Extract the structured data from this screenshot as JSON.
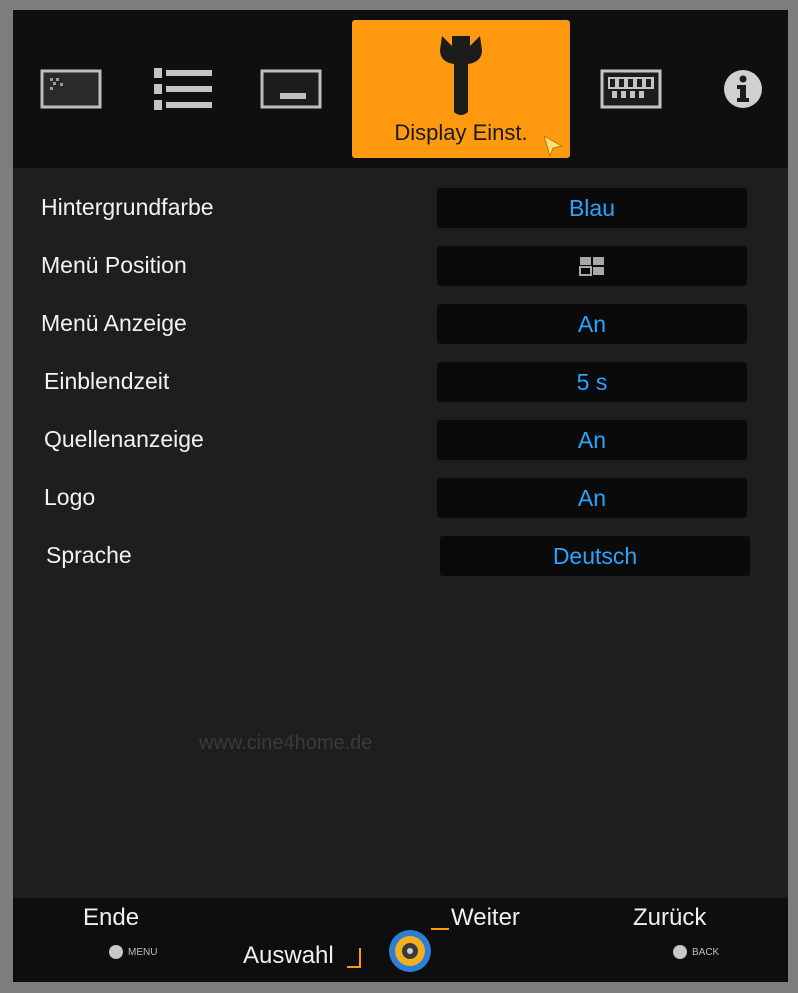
{
  "tabs": [
    {
      "icon": "picture-icon"
    },
    {
      "icon": "connection-icon"
    },
    {
      "icon": "screen-icon"
    },
    {
      "icon": "wrench-icon",
      "label": "Display Einst.",
      "active": true
    },
    {
      "icon": "keypad-icon"
    },
    {
      "icon": "info-icon"
    }
  ],
  "settings": [
    {
      "label": "Hintergrundfarbe",
      "value": "Blau"
    },
    {
      "label": "Menü Position",
      "value": "",
      "value_icon": "menu-position-icon"
    },
    {
      "label": "Menü Anzeige",
      "value": "An"
    },
    {
      "label": "Einblendzeit",
      "value": "5 s"
    },
    {
      "label": "Quellenanzeige",
      "value": "An"
    },
    {
      "label": "Logo",
      "value": "An"
    },
    {
      "label": "Sprache",
      "value": "Deutsch"
    }
  ],
  "watermark": "www.cine4home.de",
  "footer": {
    "ende": "Ende",
    "menu_key": "MENU",
    "auswahl": "Auswahl",
    "weiter": "Weiter",
    "zurueck": "Zurück",
    "back_key": "BACK"
  },
  "colors": {
    "accent": "#ff9a10",
    "value_text": "#2aa4ff",
    "background": "#1e1e1e"
  }
}
